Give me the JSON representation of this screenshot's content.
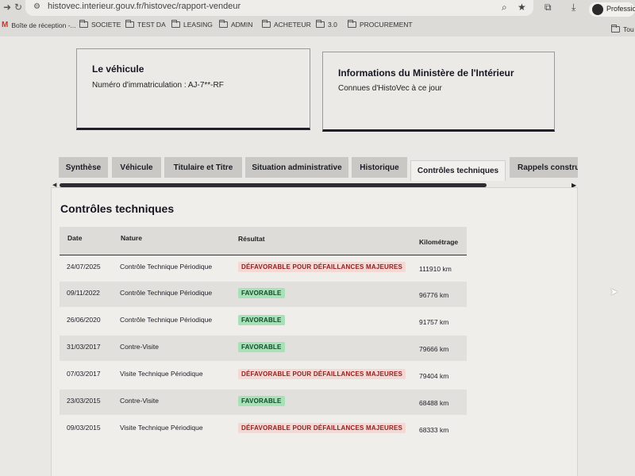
{
  "browser": {
    "url": "histovec.interieur.gouv.fr/histovec/rapport-vendeur",
    "profile_label": "Professio",
    "bookmarks": [
      {
        "label": "Boîte de réception -..."
      },
      {
        "label": "SOCIETE"
      },
      {
        "label": "TEST DA"
      },
      {
        "label": "LEASING"
      },
      {
        "label": "ADMIN"
      },
      {
        "label": "ACHETEUR"
      },
      {
        "label": "3.0"
      },
      {
        "label": "PROCUREMENT"
      },
      {
        "label": "Tou"
      }
    ]
  },
  "vehicle_card": {
    "title": "Le véhicule",
    "plate_line": "Numéro d'immatriculation : AJ-7**-RF"
  },
  "ministry_card": {
    "title": "Informations du Ministère de l'Intérieur",
    "subtitle": "Connues d'HistoVec à ce jour"
  },
  "tabs": [
    {
      "label": "Synthèse",
      "active": false
    },
    {
      "label": "Véhicule",
      "active": false
    },
    {
      "label": "Titulaire et Titre",
      "active": false
    },
    {
      "label": "Situation administrative",
      "active": false
    },
    {
      "label": "Historique",
      "active": false
    },
    {
      "label": "Contrôles techniques",
      "active": true
    },
    {
      "label": "Rappels constru",
      "active": false
    }
  ],
  "section": {
    "title": "Contrôles techniques",
    "headers": {
      "date": "Date",
      "nature": "Nature",
      "result": "Résultat",
      "mileage": "Kilométrage"
    },
    "rows": [
      {
        "date": "24/07/2025",
        "nature": "Contrôle Technique Périodique",
        "result": "DÉFAVORABLE POUR DÉFAILLANCES MAJEURES",
        "status": "bad",
        "mileage": "111910 km"
      },
      {
        "date": "09/11/2022",
        "nature": "Contrôle Technique Périodique",
        "result": "FAVORABLE",
        "status": "good",
        "mileage": "96776 km"
      },
      {
        "date": "26/06/2020",
        "nature": "Contrôle Technique Périodique",
        "result": "FAVORABLE",
        "status": "good",
        "mileage": "91757 km"
      },
      {
        "date": "31/03/2017",
        "nature": "Contre-Visite",
        "result": "FAVORABLE",
        "status": "good",
        "mileage": "79666 km"
      },
      {
        "date": "07/03/2017",
        "nature": "Visite Technique Périodique",
        "result": "DÉFAVORABLE POUR DÉFAILLANCES MAJEURES",
        "status": "bad",
        "mileage": "79404 km"
      },
      {
        "date": "23/03/2015",
        "nature": "Contre-Visite",
        "result": "FAVORABLE",
        "status": "good",
        "mileage": "68488 km"
      },
      {
        "date": "09/03/2015",
        "nature": "Visite Technique Périodique",
        "result": "DÉFAVORABLE POUR DÉFAILLANCES MAJEURES",
        "status": "bad",
        "mileage": "68333 km"
      }
    ]
  },
  "colors": {
    "unfavorable_bg": "#f3d8d4",
    "unfavorable_text": "#8f1f1f",
    "favorable_bg": "#a8e0b8",
    "favorable_text": "#124a28"
  }
}
